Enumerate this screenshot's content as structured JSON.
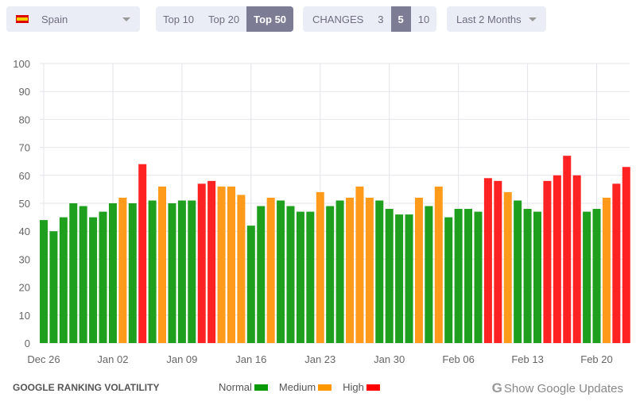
{
  "filters": {
    "country": "Spain",
    "country_flag_icon": "spain-flag-icon",
    "top_options": [
      "Top 10",
      "Top 20",
      "Top 50"
    ],
    "top_selected": "Top 50",
    "changes_label": "CHANGES",
    "changes_options": [
      "3",
      "5",
      "10"
    ],
    "changes_selected": "5",
    "period": "Last 2 Months"
  },
  "chart_data": {
    "type": "bar",
    "ylim": [
      0,
      100
    ],
    "yticks": [
      0,
      10,
      20,
      30,
      40,
      50,
      60,
      70,
      80,
      90,
      100
    ],
    "grid": true,
    "xtick_labels": [
      "Dec 26",
      "Jan 02",
      "Jan 09",
      "Jan 16",
      "Jan 23",
      "Jan 30",
      "Feb 06",
      "Feb 13",
      "Feb 20"
    ],
    "values": [
      44,
      40,
      45,
      50,
      49,
      45,
      47,
      50,
      52,
      50,
      64,
      51,
      56,
      50,
      51,
      51,
      57,
      58,
      56,
      56,
      53,
      42,
      49,
      52,
      51,
      49,
      47,
      47,
      54,
      49,
      51,
      52,
      56,
      52,
      51,
      48,
      46,
      46,
      52,
      49,
      56,
      45,
      48,
      48,
      47,
      59,
      58,
      54,
      51,
      48,
      47,
      58,
      60,
      67,
      60,
      47,
      48,
      52,
      57,
      63
    ],
    "levels": [
      "N",
      "N",
      "N",
      "N",
      "N",
      "N",
      "N",
      "N",
      "M",
      "N",
      "H",
      "N",
      "M",
      "N",
      "N",
      "N",
      "H",
      "H",
      "M",
      "M",
      "M",
      "N",
      "N",
      "M",
      "N",
      "N",
      "N",
      "N",
      "M",
      "N",
      "N",
      "M",
      "M",
      "M",
      "N",
      "N",
      "N",
      "N",
      "M",
      "N",
      "M",
      "N",
      "N",
      "N",
      "N",
      "H",
      "H",
      "M",
      "N",
      "N",
      "N",
      "H",
      "H",
      "H",
      "H",
      "N",
      "N",
      "M",
      "H",
      "H"
    ],
    "colors": {
      "N": "#1ea01e",
      "M": "#ff9a1a",
      "H": "#ff2222"
    }
  },
  "footer": {
    "title": "GOOGLE RANKING VOLATILITY",
    "legend": [
      {
        "label": "Normal",
        "color": "#0a9a0a"
      },
      {
        "label": "Medium",
        "color": "#ff9800"
      },
      {
        "label": "High",
        "color": "#ff0000"
      }
    ],
    "google_icon": "G",
    "show_updates": "Show Google Updates"
  }
}
